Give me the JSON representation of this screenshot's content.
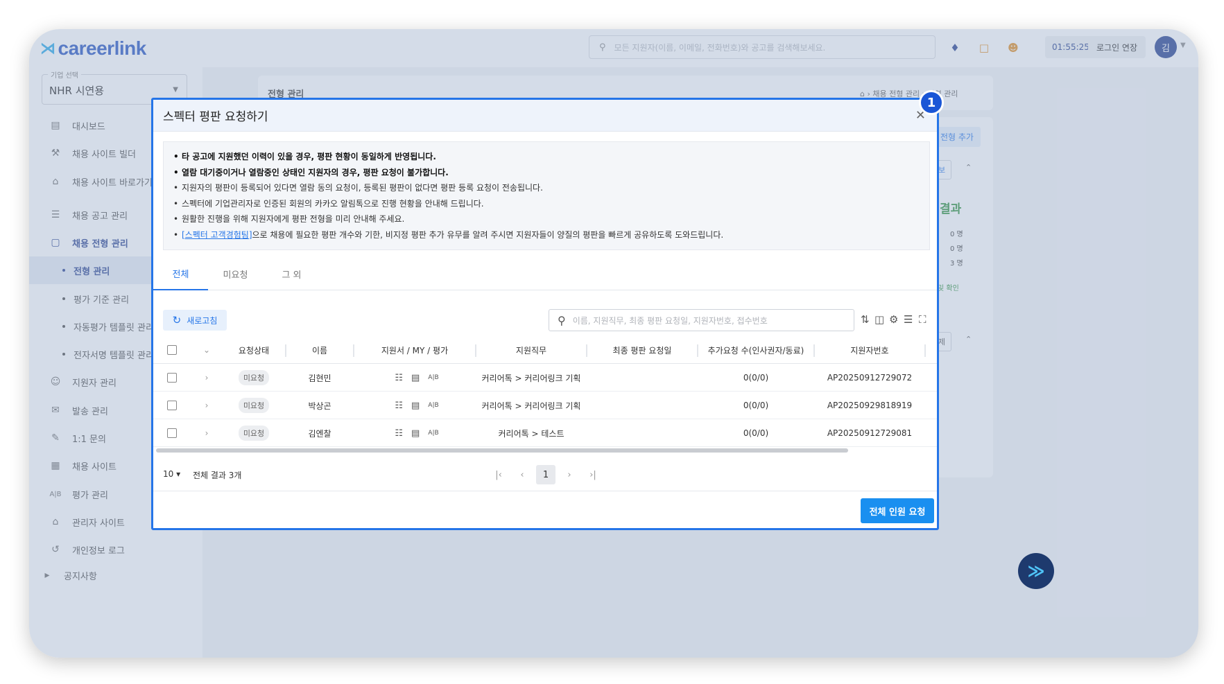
{
  "header": {
    "logo_mark": "⋊",
    "logo": "careerlink",
    "search_placeholder": "모든 지원자(이름, 이메일, 전화번호)와 공고를 검색해보세요.",
    "timer": "01:55:25",
    "extend_label": "로그인 연장",
    "avatar": "김"
  },
  "sidebar": {
    "company_label": "기업 선택",
    "company_value": "NHR 시연용",
    "items": [
      {
        "label": "대시보드",
        "icon": "chart-icon"
      },
      {
        "label": "채용 사이트 빌더",
        "icon": "tools-icon"
      },
      {
        "label": "채용 사이트 바로가기",
        "icon": "home-icon"
      },
      {
        "label": "채용 공고 관리",
        "icon": "list-icon"
      },
      {
        "label": "채용 전형 관리",
        "icon": "clipboard-icon"
      },
      {
        "label": "지원자 관리",
        "icon": "users-icon"
      },
      {
        "label": "발송 관리",
        "icon": "mail-icon"
      },
      {
        "label": "1:1 문의",
        "icon": "chat-icon"
      },
      {
        "label": "채용 사이트",
        "icon": "calendar-icon"
      },
      {
        "label": "평가 관리",
        "icon": "ab-icon"
      },
      {
        "label": "관리자 사이트",
        "icon": "home-gear-icon"
      },
      {
        "label": "개인정보 로그",
        "icon": "history-icon"
      },
      {
        "label": "공지사항",
        "icon": "megaphone-icon"
      }
    ],
    "subitems": [
      "전형 관리",
      "평가 기준 관리",
      "자동평가 템플릿 관리",
      "전자서명 템플릿 관리"
    ]
  },
  "background": {
    "page_title": "전형 관리",
    "breadcrumb": [
      "채용 전형 관리",
      "전형 관리"
    ],
    "add_button": "전형 추가",
    "btn_bo": "보",
    "btn_je": "제",
    "result_title": "결과",
    "counts": [
      "0 명",
      "0 명",
      "3 명"
    ],
    "confirm_link": "및 확인"
  },
  "modal": {
    "title": "스펙터 평판 요청하기",
    "step_badge": "1",
    "notices": [
      "타 공고에 지원했던 이력이 있을 경우, 평판 현황이 동일하게 반영됩니다.",
      "열람 대기중이거나 열람중인 상태인 지원자의 경우, 평판 요청이 불가합니다.",
      "지원자의 평판이 등록되어 있다면 열람 동의 요청이, 등록된 평판이 없다면 평판 등록 요청이 전송됩니다.",
      "스펙터에 기업관리자로 인증된 회원의 카카오 알림톡으로 진행 현황을 안내해 드립니다.",
      "원활한 진행을 위해 지원자에게 평판 전형을 미리 안내해 주세요."
    ],
    "notice_link": "[스펙터 고객경험팀]",
    "notice_last": "으로 채용에 필요한 평판 개수와 기한, 비지정 평판 추가 유무를 알려 주시면 지원자들이 양질의 평판을 빠르게 공유하도록 도와드립니다.",
    "tabs": [
      "전체",
      "미요청",
      "그 외"
    ],
    "refresh_label": "새로고침",
    "search_placeholder": "이름, 지원직무, 최종 평판 요청일, 지원자번호, 접수번호",
    "columns": [
      "요청상태",
      "이름",
      "지원서 / MY / 평가",
      "지원직무",
      "최종 평판 요청일",
      "추가요청 수(인사권자/동료)",
      "지원자번호"
    ],
    "rows": [
      {
        "status": "미요청",
        "name": "김현민",
        "job": "커리어톡 > 커리어링크 기획",
        "date": "",
        "count": "0(0/0)",
        "id": "AP20250912729072"
      },
      {
        "status": "미요청",
        "name": "박상곤",
        "job": "커리어톡 > 커리어링크 기획",
        "date": "",
        "count": "0(0/0)",
        "id": "AP20250929818919"
      },
      {
        "status": "미요청",
        "name": "김엔찰",
        "job": "커리어톡 > 테스트",
        "date": "",
        "count": "0(0/0)",
        "id": "AP20250912729081"
      }
    ],
    "ab_label": "A|B",
    "page_size": "10",
    "total": "전체 결과 3개",
    "current_page": "1",
    "request_all": "전체 인원 요청"
  }
}
